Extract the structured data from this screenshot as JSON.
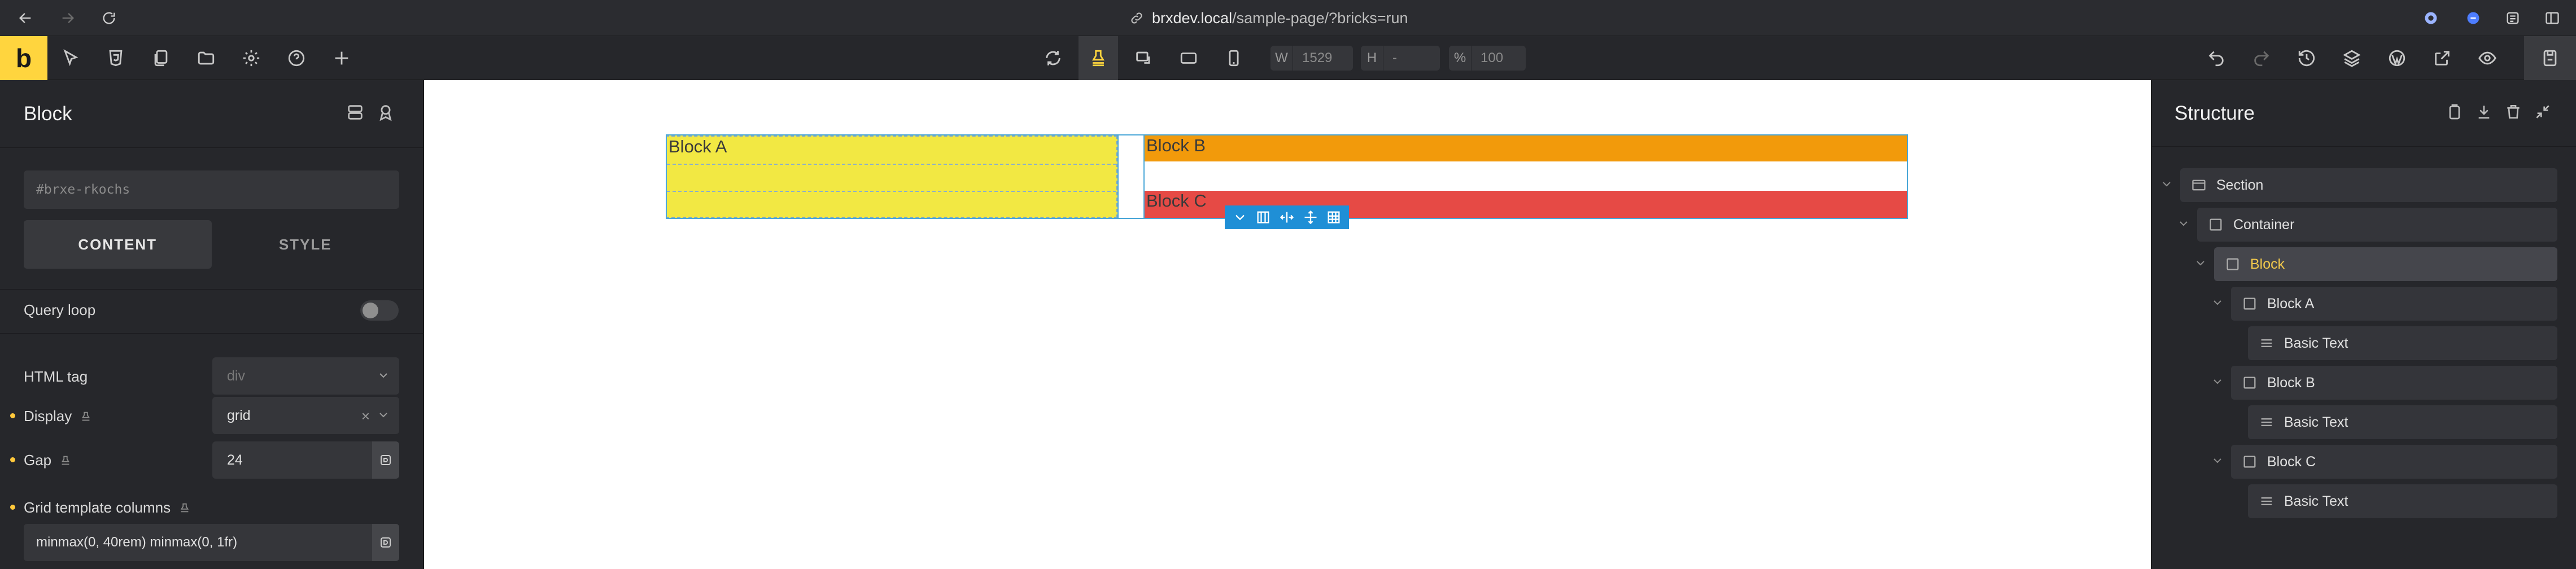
{
  "browser": {
    "url_host": "brxdev.local",
    "url_path": "/sample-page/?bricks=run"
  },
  "toolbar": {
    "logo": "b",
    "width_label": "W",
    "width_value": "1529",
    "height_label": "H",
    "height_value": "-",
    "zoom_label": "%",
    "zoom_value": "100"
  },
  "left_panel": {
    "title": "Block",
    "id_value": "#brxe-rkochs",
    "tabs": {
      "content": "CONTENT",
      "style": "STYLE"
    },
    "query_loop_label": "Query loop",
    "html_tag_label": "HTML tag",
    "html_tag_value": "div",
    "display_label": "Display",
    "display_value": "grid",
    "gap_label": "Gap",
    "gap_value": "24",
    "grid_template_columns_label": "Grid template columns",
    "grid_template_columns_value": "minmax(0, 40rem) minmax(0, 1fr)"
  },
  "canvas": {
    "block_a": "Block A",
    "block_b": "Block B",
    "block_c": "Block C",
    "colors": {
      "block_a": "#f2e843",
      "block_b": "#f29a0b",
      "block_c": "#e64a45",
      "selection": "#1f8fd6"
    }
  },
  "structure": {
    "title": "Structure",
    "items": [
      {
        "label": "Section",
        "icon": "section-icon"
      },
      {
        "label": "Container",
        "icon": "container-icon"
      },
      {
        "label": "Block",
        "icon": "block-icon",
        "selected": true
      },
      {
        "label": "Block A",
        "icon": "block-icon"
      },
      {
        "label": "Basic Text",
        "icon": "text-icon"
      },
      {
        "label": "Block B",
        "icon": "block-icon"
      },
      {
        "label": "Basic Text",
        "icon": "text-icon"
      },
      {
        "label": "Block C",
        "icon": "block-icon"
      },
      {
        "label": "Basic Text",
        "icon": "text-icon"
      }
    ]
  }
}
